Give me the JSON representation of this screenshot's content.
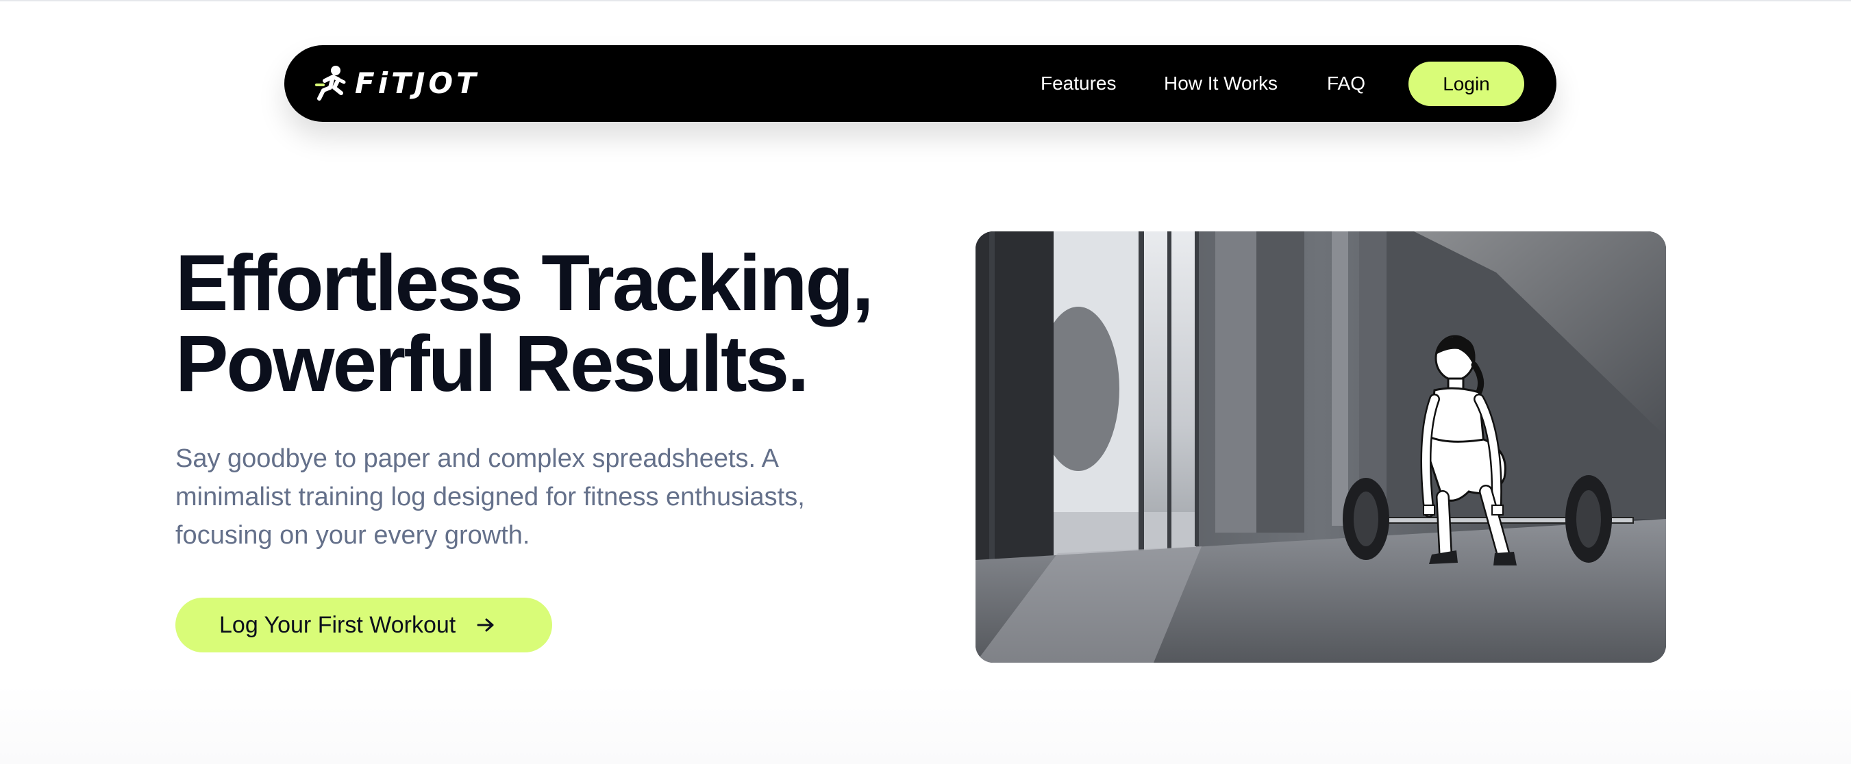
{
  "nav": {
    "brand": "FiTJOT",
    "links": {
      "features": "Features",
      "how_it_works": "How It Works",
      "faq": "FAQ"
    },
    "login_label": "Login"
  },
  "hero": {
    "title_line1": "Effortless Tracking,",
    "title_line2": "Powerful Results.",
    "description_line1": "Say goodbye to paper and complex spreadsheets. A",
    "description_line2": "minimalist training log designed for fitness enthusiasts,",
    "description_line3": "focusing on your every growth.",
    "cta_label": "Log Your First Workout"
  },
  "colors": {
    "accent": "#d9fc78",
    "nav_background": "#000000",
    "heading": "#0b0f1c",
    "body_text": "#64708a"
  },
  "icons": {
    "brand": "running-figure-icon",
    "cta": "arrow-right-icon"
  }
}
